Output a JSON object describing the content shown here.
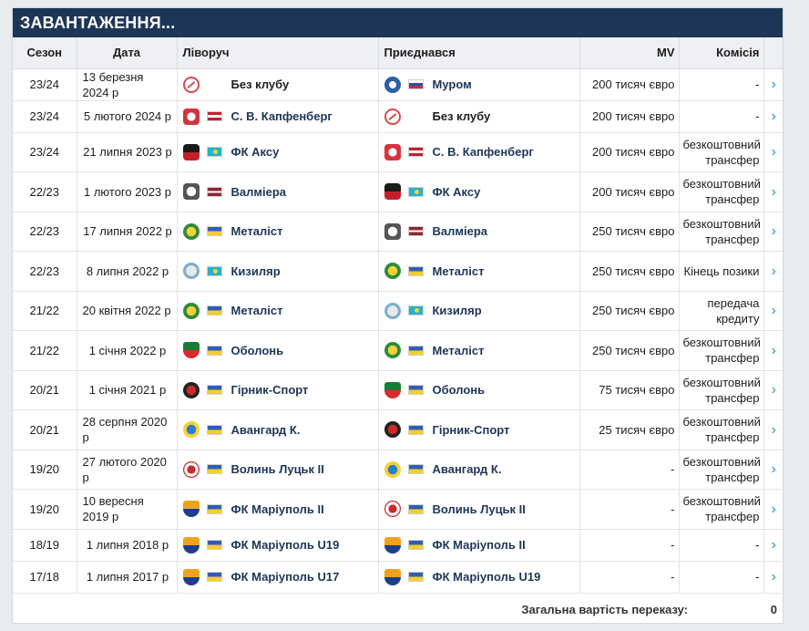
{
  "panel": {
    "title": "ЗАВАНТАЖЕННЯ..."
  },
  "columns": {
    "season": "Сезон",
    "date": "Дата",
    "left": "Ліворуч",
    "joined": "Приєднався",
    "mv": "MV",
    "fee": "Комісія"
  },
  "rows": [
    {
      "season": "23/24",
      "date": "13 березня 2024 р",
      "left": "Без клубу",
      "left_crest": "no-club-icon",
      "left_flag": "",
      "joined": "Муром",
      "joined_crest": "murom-crest-icon",
      "joined_flag": "ru",
      "mv": "200 тисяч євро",
      "fee": "-"
    },
    {
      "season": "23/24",
      "date": "5 лютого 2024 р",
      "left": "С. В. Капфенберг",
      "left_crest": "kapfenberg-crest-icon",
      "left_flag": "at",
      "joined": "Без клубу",
      "joined_crest": "no-club-icon",
      "joined_flag": "",
      "mv": "200 тисяч євро",
      "fee": "-"
    },
    {
      "season": "23/24",
      "date": "21 липня 2023 р",
      "left": "ФК Аксу",
      "left_crest": "aksu-crest-icon",
      "left_flag": "kz",
      "joined": "С. В. Капфенберг",
      "joined_crest": "kapfenberg-crest-icon",
      "joined_flag": "at",
      "mv": "200 тисяч євро",
      "fee": "безкоштовний трансфер"
    },
    {
      "season": "22/23",
      "date": "1 лютого 2023 р",
      "left": "Валміера",
      "left_crest": "valmiera-crest-icon",
      "left_flag": "lv",
      "joined": "ФК Аксу",
      "joined_crest": "aksu-crest-icon",
      "joined_flag": "kz",
      "mv": "200 тисяч євро",
      "fee": "безкоштовний трансфер"
    },
    {
      "season": "22/23",
      "date": "17 липня 2022 р",
      "left": "Металіст",
      "left_crest": "metalist-crest-icon",
      "left_flag": "ua",
      "joined": "Валміера",
      "joined_crest": "valmiera-crest-icon",
      "joined_flag": "lv",
      "mv": "250 тисяч євро",
      "fee": "безкоштовний трансфер"
    },
    {
      "season": "22/23",
      "date": "8 липня 2022 р",
      "left": "Кизиляр",
      "left_crest": "kyzylzhar-crest-icon",
      "left_flag": "kz",
      "joined": "Металіст",
      "joined_crest": "metalist-crest-icon",
      "joined_flag": "ua",
      "mv": "250 тисяч євро",
      "fee": "Кінець позики"
    },
    {
      "season": "21/22",
      "date": "20 квітня 2022 р",
      "left": "Металіст",
      "left_crest": "metalist-crest-icon",
      "left_flag": "ua",
      "joined": "Кизиляр",
      "joined_crest": "kyzylzhar-crest-icon",
      "joined_flag": "kz",
      "mv": "250 тисяч євро",
      "fee": "передача кредиту"
    },
    {
      "season": "21/22",
      "date": "1 січня 2022 р",
      "left": "Оболонь",
      "left_crest": "obolon-crest-icon",
      "left_flag": "ua",
      "joined": "Металіст",
      "joined_crest": "metalist-crest-icon",
      "joined_flag": "ua",
      "mv": "250 тисяч євро",
      "fee": "безкоштовний трансфер"
    },
    {
      "season": "20/21",
      "date": "1 січня 2021 р",
      "left": "Гірник-Спорт",
      "left_crest": "hirnyk-crest-icon",
      "left_flag": "ua",
      "joined": "Оболонь",
      "joined_crest": "obolon-crest-icon",
      "joined_flag": "ua",
      "mv": "75 тисяч євро",
      "fee": "безкоштовний трансфер"
    },
    {
      "season": "20/21",
      "date": "28 серпня 2020 р",
      "left": "Авангард К.",
      "left_crest": "avangard-crest-icon",
      "left_flag": "ua",
      "joined": "Гірник-Спорт",
      "joined_crest": "hirnyk-crest-icon",
      "joined_flag": "ua",
      "mv": "25 тисяч євро",
      "fee": "безкоштовний трансфер"
    },
    {
      "season": "19/20",
      "date": "27 лютого 2020 р",
      "left": "Волинь Луцьк II",
      "left_crest": "volyn-crest-icon",
      "left_flag": "ua",
      "joined": "Авангард К.",
      "joined_crest": "avangard-crest-icon",
      "joined_flag": "ua",
      "mv": "-",
      "fee": "безкоштовний трансфер"
    },
    {
      "season": "19/20",
      "date": "10 вересня 2019 р",
      "left": "ФК Маріуполь II",
      "left_crest": "mariupol-crest-icon",
      "left_flag": "ua",
      "joined": "Волинь Луцьк II",
      "joined_crest": "volyn-crest-icon",
      "joined_flag": "ua",
      "mv": "-",
      "fee": "безкоштовний трансфер"
    },
    {
      "season": "18/19",
      "date": "1 липня 2018 р",
      "left": "ФК Маріуполь U19",
      "left_crest": "mariupol-crest-icon",
      "left_flag": "ua",
      "joined": "ФК Маріуполь II",
      "joined_crest": "mariupol-crest-icon",
      "joined_flag": "ua",
      "mv": "-",
      "fee": "-"
    },
    {
      "season": "17/18",
      "date": "1 липня 2017 р",
      "left": "ФК Маріуполь U17",
      "left_crest": "mariupol-crest-icon",
      "left_flag": "ua",
      "joined": "ФК Маріуполь U19",
      "joined_crest": "mariupol-crest-icon",
      "joined_flag": "ua",
      "mv": "-",
      "fee": "-"
    }
  ],
  "footer": {
    "label": "Загальна вартість переказу:",
    "value": "0"
  },
  "arrow_glyph": "›"
}
